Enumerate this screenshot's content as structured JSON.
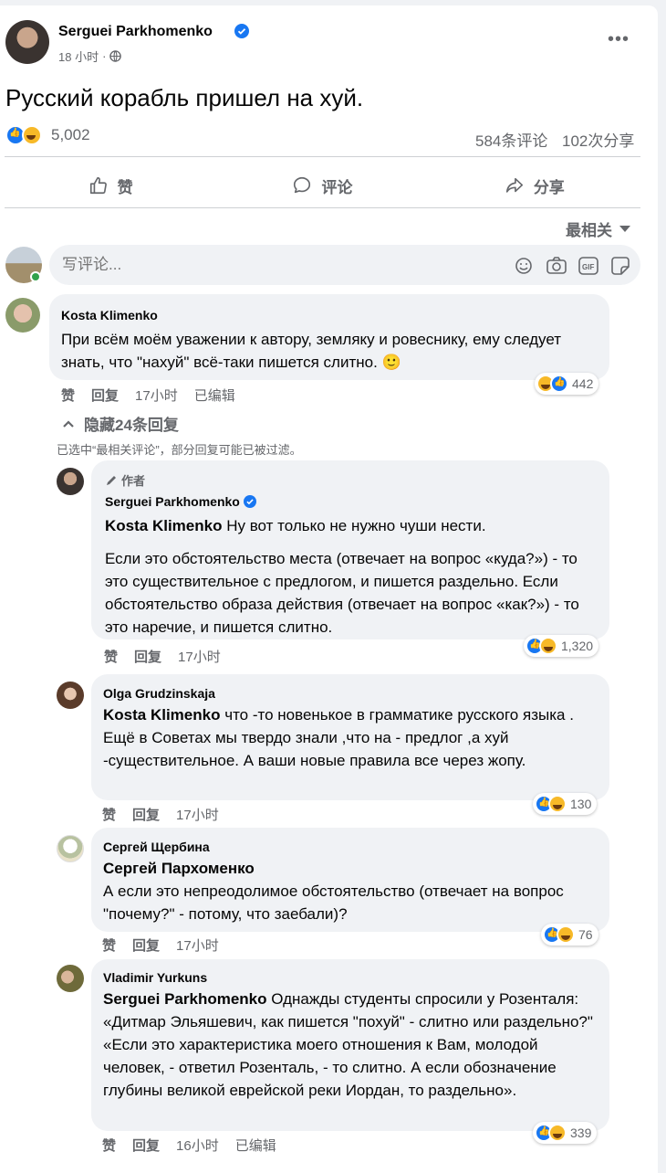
{
  "post": {
    "author": "Serguei Parkhomenko",
    "time": "18 小时",
    "dot": "·",
    "text": "Русский корабль пришел на хуй.",
    "reaction_count": "5,002",
    "comments_count": "584条评论",
    "shares_count": "102次分享"
  },
  "actions": {
    "like": "赞",
    "comment": "评论",
    "share": "分享"
  },
  "sort": {
    "label": "最相关",
    "icon": "caret-down-icon"
  },
  "composer": {
    "placeholder": "写评论..."
  },
  "comments": [
    {
      "name": "Kosta Klimenko",
      "text": "При всём моём уважении к автору, земляку и ровеснику, ему следует знать, что \"нахуй\" всё-таки пишется слитно. 🙂",
      "like": "赞",
      "reply": "回复",
      "time": "17小时",
      "edited": "已编辑",
      "reactions": "442"
    }
  ],
  "replies_toggle": "隐藏24条回复",
  "filter_note": "已选中“最相关评论”，部分回复可能已被过滤。",
  "replies": [
    {
      "badge": "作者",
      "name": "Serguei Parkhomenko",
      "mention": "Kosta Klimenko",
      "text1": " Ну вот только не нужно чуши нести.",
      "text2": "Если это обстоятельство места (отвечает на вопрос «куда?») - то это существительное с предлогом, и пишется раздельно. Если обстоятельство образа действия (отвечает на вопрос «как?») - то это наречие, и пишется слитно.",
      "like": "赞",
      "reply": "回复",
      "time": "17小时",
      "reactions": "1,320"
    },
    {
      "name": "Olga Grudzinskaja",
      "mention": "Kosta Klimenko",
      "text1": " что -то новенькое в грамматике русского языка . Ещё в Советах мы твердо знали ,что на - предлог ,а хуй -существительное. А ваши новые правила все через жопу.",
      "like": "赞",
      "reply": "回复",
      "time": "17小时",
      "reactions": "130"
    },
    {
      "name": "Сергей Щербина",
      "mention": "Сергей Пархоменко",
      "text1": "А если это непреодолимое обстоятельство (отвечает на вопрос \"почему?\" - потому, что заебали)?",
      "like": "赞",
      "reply": "回复",
      "time": "17小时",
      "reactions": "76"
    },
    {
      "name": "Vladimir Yurkuns",
      "mention": "Serguei Parkhomenko",
      "text1": " Однажды студенты спросили у Розенталя: «Дитмар Эльяшевич, как пишется \"похуй\" - слитно или раздельно?\" «Если это характеристика моего отношения к Вам, молодой человек, - ответил Розенталь, - то слитно. А если обозначение глубины великой еврейской реки Иордан, то раздельно».",
      "like": "赞",
      "reply": "回复",
      "time": "16小时",
      "edited": "已编辑",
      "reactions": "339"
    }
  ],
  "colors": {
    "accent": "#1877f2",
    "muted": "#65676b",
    "bubble": "#f0f2f5"
  }
}
